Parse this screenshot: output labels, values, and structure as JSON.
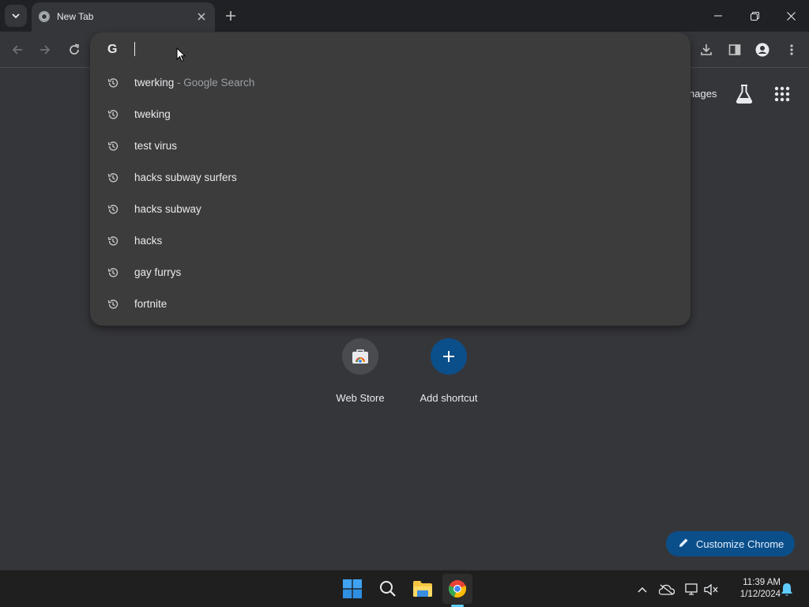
{
  "window": {
    "tab_title": "New Tab",
    "controls": [
      "minimize",
      "restore",
      "close"
    ]
  },
  "toolbar": {
    "buttons": [
      "back",
      "forward",
      "reload",
      "downloads",
      "side-panel",
      "profile",
      "menu"
    ]
  },
  "omnibox": {
    "value": "",
    "engine_icon": "G",
    "suggestions": [
      {
        "text": "twerking",
        "sub": " - Google Search"
      },
      {
        "text": "tweking",
        "sub": ""
      },
      {
        "text": "test virus",
        "sub": ""
      },
      {
        "text": "hacks subway surfers",
        "sub": ""
      },
      {
        "text": "hacks subway",
        "sub": ""
      },
      {
        "text": "hacks",
        "sub": ""
      },
      {
        "text": "gay furrys",
        "sub": ""
      },
      {
        "text": "fortnite",
        "sub": ""
      }
    ]
  },
  "ntp": {
    "images_link": "nages",
    "shortcuts": [
      {
        "label": "Web Store"
      },
      {
        "label": "Add shortcut"
      }
    ],
    "customize_label": "Customize Chrome"
  },
  "taskbar": {
    "time": "11:39 AM",
    "date": "1/12/2024"
  },
  "colors": {
    "background": "#35363a",
    "accent": "#0b4f8a",
    "taskbar": "#1f1f1f"
  }
}
